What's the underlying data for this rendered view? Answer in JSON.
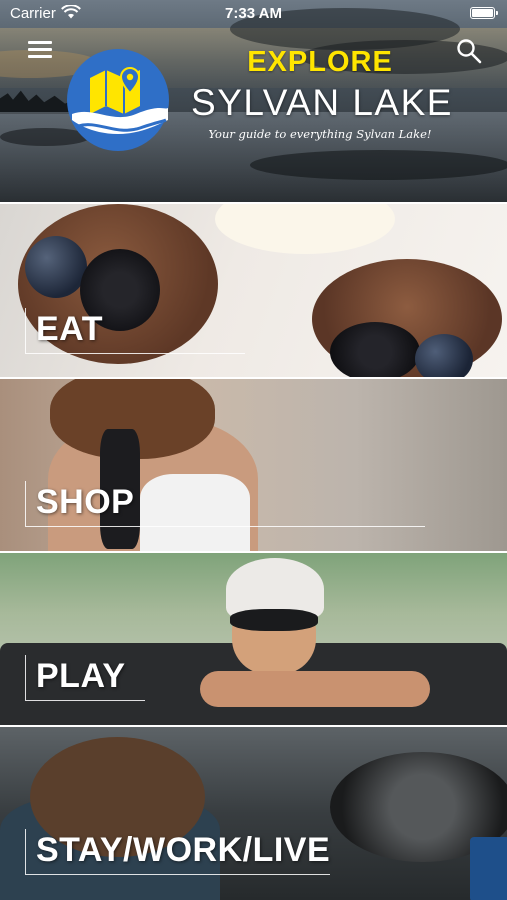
{
  "status_bar": {
    "carrier": "Carrier",
    "time": "7:33 AM"
  },
  "header": {
    "title_top": "EXPLORE",
    "title_main": "SYLVAN LAKE",
    "tagline": "Your guide to everything Sylvan Lake!",
    "menu_icon": "hamburger-menu-icon",
    "search_icon": "magnifier-search-icon"
  },
  "colors": {
    "explore_yellow": "#ffe500",
    "logo_blue": "#2f6fc7",
    "logo_yellow": "#ffe500"
  },
  "categories": [
    {
      "label": "EAT"
    },
    {
      "label": "SHOP"
    },
    {
      "label": "PLAY"
    },
    {
      "label": "STAY/WORK/LIVE"
    }
  ]
}
